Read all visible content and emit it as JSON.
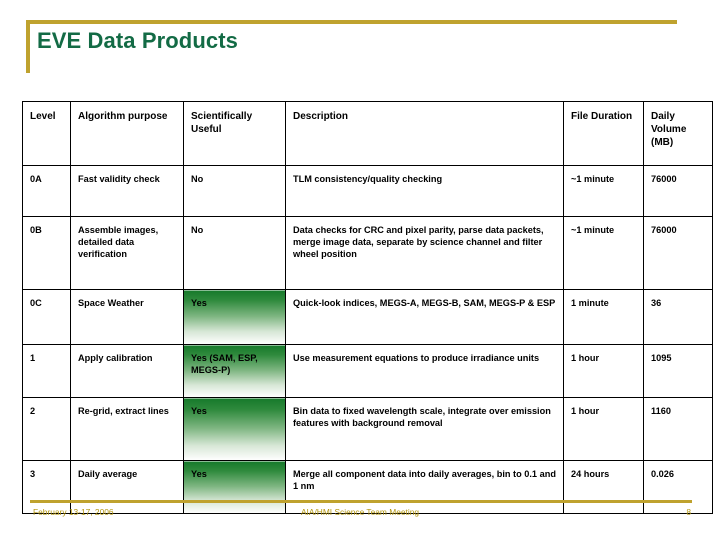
{
  "slide": {
    "title": "EVE Data Products",
    "accent_gold": "#bfa22e",
    "title_green": "#136b45",
    "yes_gradient_green": "#167a2b"
  },
  "table": {
    "headers": {
      "level": "Level",
      "algorithm": "Algorithm purpose",
      "scientifically_useful": "Scientifically Useful",
      "description": "Description",
      "file_duration": "File Duration",
      "daily_volume": "Daily Volume (MB)"
    },
    "rows": [
      {
        "level": "0A",
        "algorithm": "Fast validity check",
        "useful": "No",
        "useful_highlight": false,
        "useful_extra": "",
        "description": "TLM consistency/quality checking",
        "file_duration": "~1 minute",
        "daily_volume": "76000"
      },
      {
        "level": "0B",
        "algorithm": "Assemble images, detailed data verification",
        "useful": "No",
        "useful_highlight": false,
        "useful_extra": "",
        "description": "Data checks for CRC and pixel parity, parse data packets, merge image data, separate by science channel and filter wheel position",
        "file_duration": "~1 minute",
        "daily_volume": "76000"
      },
      {
        "level": "0C",
        "algorithm": "Space Weather",
        "useful": "Yes",
        "useful_highlight": true,
        "useful_extra": "",
        "description": "Quick-look indices, MEGS-A, MEGS-B, SAM, MEGS-P & ESP",
        "file_duration": "1 minute",
        "daily_volume": "36"
      },
      {
        "level": "1",
        "algorithm": "Apply calibration",
        "useful": "Yes",
        "useful_highlight": true,
        "useful_extra": "(SAM, ESP, MEGS-P)",
        "description": "Use measurement equations to produce irradiance units",
        "file_duration": "1 hour",
        "daily_volume": "1095"
      },
      {
        "level": "2",
        "algorithm": "Re-grid, extract lines",
        "useful": "Yes",
        "useful_highlight": true,
        "useful_extra": "",
        "description": "Bin data to fixed wavelength scale, integrate over emission features with background removal",
        "file_duration": "1 hour",
        "daily_volume": "1160"
      },
      {
        "level": "3",
        "algorithm": "Daily average",
        "useful": "Yes",
        "useful_highlight": true,
        "useful_extra": "",
        "description": "Merge all component data into daily averages, bin to 0.1 and 1 nm",
        "file_duration": "24 hours",
        "daily_volume": "0.026"
      }
    ]
  },
  "footer": {
    "date": "February 13-17, 2006",
    "meeting": "AIA/HMI Science Team Meeting",
    "page_number": "8"
  }
}
